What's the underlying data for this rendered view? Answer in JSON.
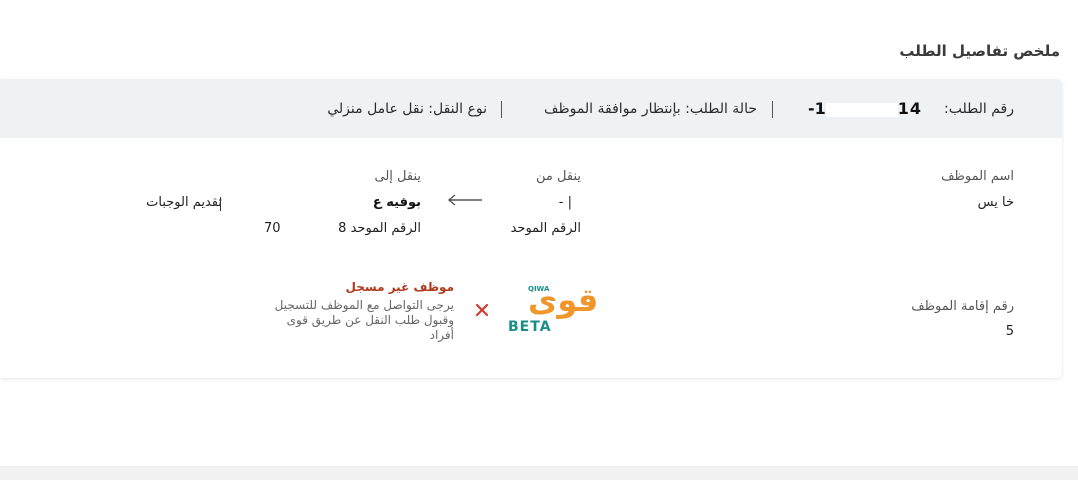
{
  "summary": {
    "title": "ملخص تفاصيل الطلب",
    "request_number_label": "رقم الطلب:",
    "request_number_value": "14- 1-",
    "request_status_text": "حالة الطلب: بإنتظار موافقة الموظف",
    "transfer_type_text": "نوع النقل: نقل عامل منزلي"
  },
  "employee": {
    "name_label": "اسم الموظف",
    "name_value": "خا يس",
    "iqama_label": "رقم إقامة الموظف",
    "iqama_value": "5"
  },
  "transfer_from": {
    "label": "ينقل من",
    "value": "| -",
    "unified_label": "الرقم الموحد"
  },
  "transfer_to": {
    "label": "ينقل إلى",
    "name_value": "بوفيه ع",
    "activity_value": "تقديم الوجبات",
    "unified_text": "الرقم الموحد 8",
    "unified_tail": "70"
  },
  "qiwa": {
    "logo_text": "قوى",
    "logo_latin": "QIWA",
    "beta_label": "BETA",
    "status_icon": "x-icon",
    "warning_title": "موظف غير مسجل",
    "warning_line1": "يرجى التواصل مع الموظف للتسجيل",
    "warning_line2": "وقبول طلب النقل عن طريق قوى",
    "warning_line3": "أفراد"
  },
  "colors": {
    "header_bg": "#eef2f5",
    "warning": "#b03a1e",
    "cross": "#d23b2f",
    "qiwa_orange": "#f0962b",
    "qiwa_teal": "#1a8f8a"
  }
}
